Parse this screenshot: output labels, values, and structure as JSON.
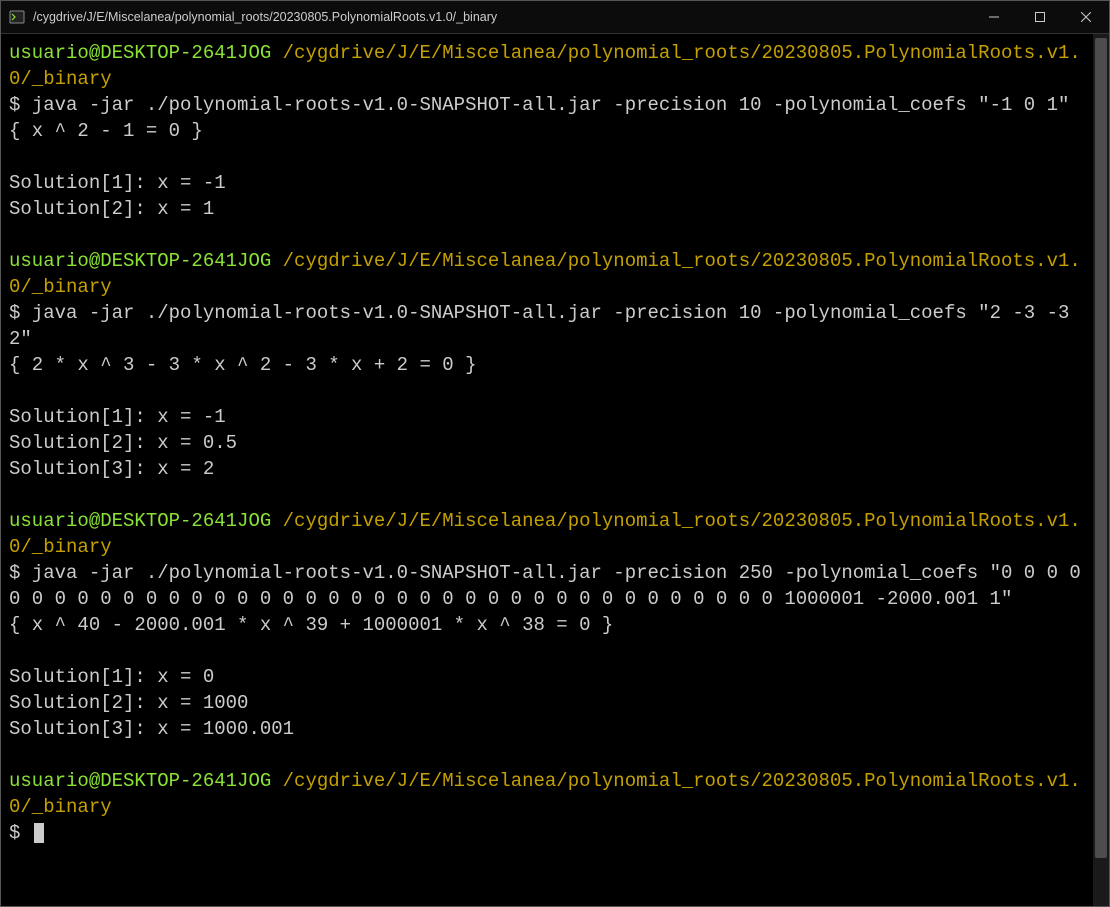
{
  "window": {
    "title": "/cygdrive/J/E/Miscelanea/polynomial_roots/20230805.PolynomialRoots.v1.0/_binary"
  },
  "prompt": {
    "user": "usuario",
    "at": "@",
    "host": "DESKTOP-2641JOG",
    "path": "/cygdrive/J/E/Miscelanea/polynomial_roots/20230805.PolynomialRoots.v1.0/_binary",
    "symbol": "$"
  },
  "blocks": [
    {
      "command": "java -jar ./polynomial-roots-v1.0-SNAPSHOT-all.jar -precision 10 -polynomial_coefs \"-1 0 1\"",
      "output": [
        "{ x ^ 2 - 1 = 0 }",
        "",
        "Solution[1]: x = -1",
        "Solution[2]: x = 1"
      ]
    },
    {
      "command": "java -jar ./polynomial-roots-v1.0-SNAPSHOT-all.jar -precision 10 -polynomial_coefs \"2 -3 -3 2\"",
      "output": [
        "{ 2 * x ^ 3 - 3 * x ^ 2 - 3 * x + 2 = 0 }",
        "",
        "Solution[1]: x = -1",
        "Solution[2]: x = 0.5",
        "Solution[3]: x = 2"
      ]
    },
    {
      "command": "java -jar ./polynomial-roots-v1.0-SNAPSHOT-all.jar -precision 250 -polynomial_coefs \"0 0 0 0 0 0 0 0 0 0 0 0 0 0 0 0 0 0 0 0 0 0 0 0 0 0 0 0 0 0 0 0 0 0 0 0 0 0 1000001 -2000.001 1\"",
      "output": [
        "{ x ^ 40 - 2000.001 * x ^ 39 + 1000001 * x ^ 38 = 0 }",
        "",
        "Solution[1]: x = 0",
        "Solution[2]: x = 1000",
        "Solution[3]: x = 1000.001"
      ]
    }
  ],
  "final_prompt_input": ""
}
